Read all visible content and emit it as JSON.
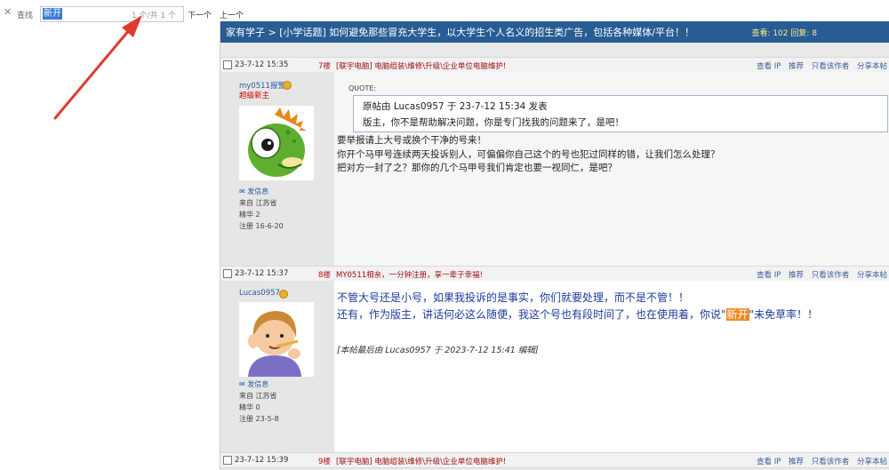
{
  "findbar": {
    "find_label": "查找",
    "query": "新开",
    "count": "1 个/共 1 个",
    "next": "下一个",
    "prev": "上一个"
  },
  "topic": {
    "breadcrumb": "家有学子  >  [小学话题] 如何避免那些冒充大学生，以大学生个人名义的招生类广告，包括各种媒体/平台！！",
    "stats": "查看: 102  回复: 8"
  },
  "post_actions": [
    "查看 IP",
    "推荐",
    "只看该作者",
    "分享本帖"
  ],
  "posts": [
    {
      "date": "23-7-12 15:35",
      "floor": "7楼",
      "signature": "[联宇电脑] 电脑组装\\维修\\升级\\企业单位电脑维护!",
      "author": "my0511报警",
      "rank": "超级新主",
      "info": [
        "发信息",
        "来自 江苏省",
        "精华 2",
        "注册 16-6-20"
      ],
      "quote_label": "QUOTE:",
      "quote_line1": "原帖由 Lucas0957 于 23-7-12 15:34 发表",
      "quote_line2": "版主，你不是帮助解决问题，你是专门找我的问题来了，是吧！",
      "lines": [
        "要举报请上大号或换个干净的号来！",
        "你开个马甲号连续两天投诉别人，可偏偏你自己这个的号也犯过同样的错，让我们怎么处理？",
        "把对方一封了之？那你的几个马甲号我们肯定也要一视同仁，是吧？"
      ]
    },
    {
      "date": "23-7-12 15:37",
      "floor": "8楼",
      "signature": "MY0511相亲，一分钟注册，享一辈子幸福!",
      "author": "Lucas0957",
      "info": [
        "发信息",
        "来自 江苏省",
        "精华 0",
        "注册 23-5-8"
      ],
      "line1": "不管大号还是小号，如果我投诉的是事实，你们就要处理，而不是不管！！",
      "line2_pre": "还有，作为版主，讲话何必这么随便，我这个号也有段时间了，也在使用着，你说\"",
      "line2_hl": "新开",
      "line2_post": "\"未免草率！！",
      "edit_note": "[本帖最后由 Lucas0957 于 2023-7-12 15:41 编辑]"
    },
    {
      "date": "23-7-12 15:39",
      "floor": "9楼",
      "signature": "[联宇电脑] 电脑组装\\维修\\升级\\企业单位电脑维护!"
    }
  ],
  "colors": {
    "topic_bar": "#285c94",
    "highlight": "#f08a26",
    "arrow": "#e03a2e"
  }
}
